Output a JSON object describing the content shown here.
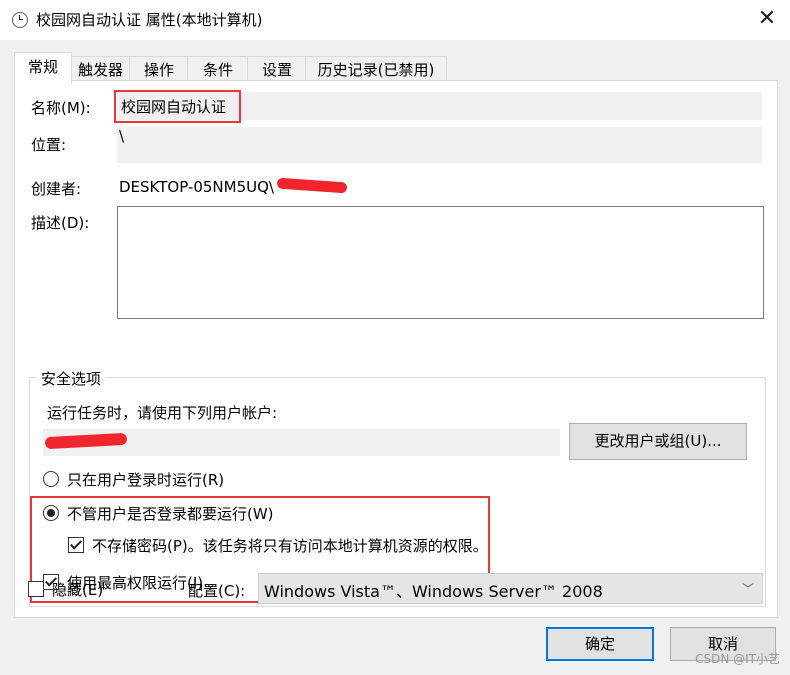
{
  "window": {
    "title": "校园网自动认证 属性(本地计算机)",
    "close_glyph": "✕"
  },
  "tabs": [
    {
      "label": "常规"
    },
    {
      "label": "触发器"
    },
    {
      "label": "操作"
    },
    {
      "label": "条件"
    },
    {
      "label": "设置"
    },
    {
      "label": "历史记录(已禁用)"
    }
  ],
  "general": {
    "name_label": "名称(M):",
    "name_value": "校园网自动认证",
    "location_label": "位置:",
    "location_value": "\\",
    "author_label": "创建者:",
    "author_value": "DESKTOP-05NM5UQ\\",
    "description_label": "描述(D):",
    "description_value": ""
  },
  "security": {
    "group_title": "安全选项",
    "run_as_text": "运行任务时，请使用下列用户帐户:",
    "change_user_button": "更改用户或组(U)...",
    "option_logged_on": "只在用户登录时运行(R)",
    "option_whether_logged": "不管用户是否登录都要运行(W)",
    "option_no_store_password": "不存储密码(P)。该任务将只有访问本地计算机资源的权限。",
    "option_highest_privileges": "使用最高权限运行(I)"
  },
  "bottom": {
    "hidden_label": "隐藏(E)",
    "config_label": "配置(C):",
    "config_value": "Windows Vista™、Windows Server™ 2008",
    "ok_button": "确定",
    "cancel_button": "取消",
    "watermark": "CSDN @IT小艺"
  },
  "colors": {
    "accent": "#0078d7",
    "highlight": "#e8373c"
  }
}
